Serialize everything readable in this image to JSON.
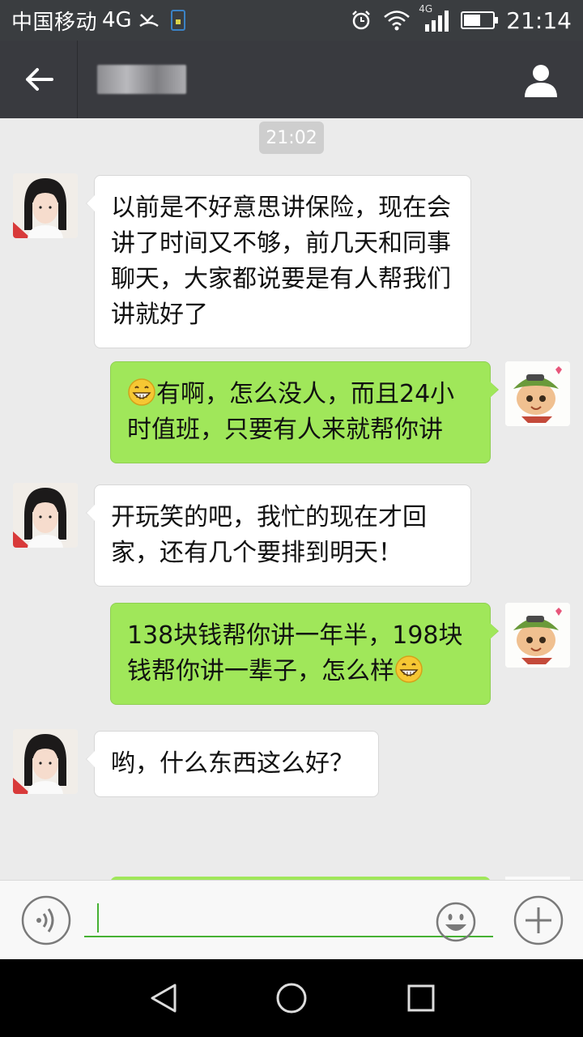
{
  "statusbar": {
    "carrier": "中国移动",
    "network": "4G",
    "mini_network": "4G",
    "time": "21:14"
  },
  "titlebar": {
    "back_icon": "arrow-left-icon",
    "contact_icon": "person-icon"
  },
  "chat": {
    "timestamp": "21:02",
    "messages": [
      {
        "side": "left",
        "text": "以前是不好意思讲保险，现在会讲了时间又不够，前几天和同事聊天，大家都说要是有人帮我们讲就好了"
      },
      {
        "side": "right",
        "text": "有啊，怎么没人，而且24小时值班，只要有人来就帮你讲",
        "emoji": "grin-emoji"
      },
      {
        "side": "left",
        "text": "开玩笑的吧，我忙的现在才回家，还有几个要排到明天！"
      },
      {
        "side": "right",
        "text": "138块钱帮你讲一年半，198块钱帮你讲一辈子，怎么样",
        "emoji": "grin-emoji"
      },
      {
        "side": "left",
        "text": "哟，什么东西这么好？"
      }
    ]
  },
  "inputbar": {
    "voice_icon": "voice-icon",
    "emoji_icon": "smiley-icon",
    "plus_icon": "plus-icon",
    "value": ""
  },
  "navbar": {
    "back_icon": "triangle-back-icon",
    "home_icon": "circle-home-icon",
    "recent_icon": "square-recent-icon"
  },
  "colors": {
    "titlebar": "#393a3f",
    "sent_bubble": "#a0e75a",
    "received_bubble": "#ffffff",
    "chat_bg": "#ebebeb",
    "accent": "#46b133"
  }
}
